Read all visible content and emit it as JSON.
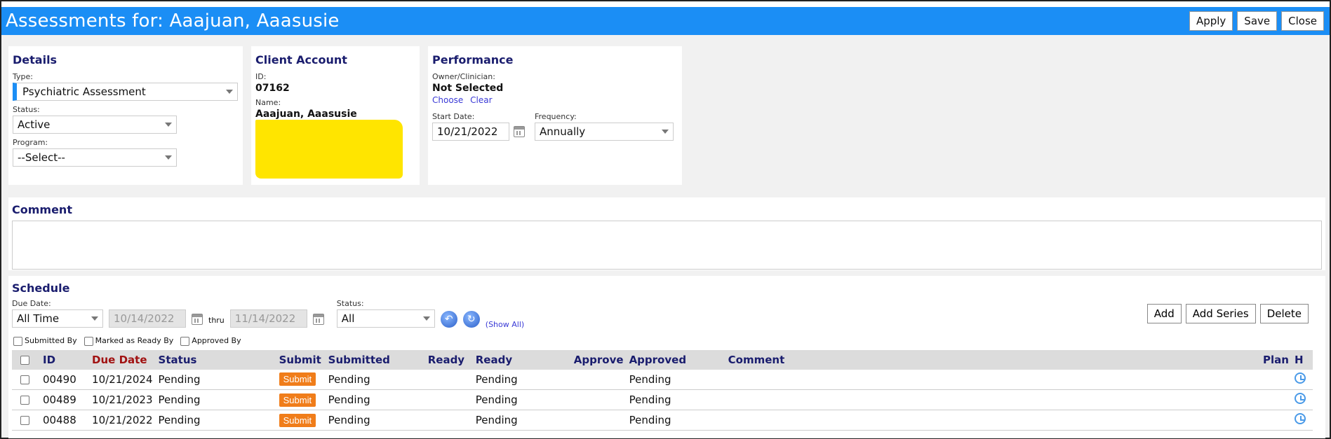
{
  "title": "Assessments for: Aaajuan, Aaasusie",
  "toolbar": {
    "apply": "Apply",
    "save": "Save",
    "close": "Close"
  },
  "details": {
    "heading": "Details",
    "type_label": "Type:",
    "type_value": "Psychiatric Assessment",
    "status_label": "Status:",
    "status_value": "Active",
    "program_label": "Program:",
    "program_value": "--Select--"
  },
  "client": {
    "heading": "Client Account",
    "id_label": "ID:",
    "id_value": "07162",
    "name_label": "Name:",
    "name_value": "Aaajuan, Aaasusie"
  },
  "performance": {
    "heading": "Performance",
    "owner_label": "Owner/Clinician:",
    "owner_value": "Not Selected",
    "choose": "Choose",
    "clear": "Clear",
    "start_label": "Start Date:",
    "start_value": "10/21/2022",
    "freq_label": "Frequency:",
    "freq_value": "Annually"
  },
  "comment": {
    "heading": "Comment",
    "value": ""
  },
  "schedule": {
    "heading": "Schedule",
    "due_label": "Due Date:",
    "due_value": "All Time",
    "from_date": "10/14/2022",
    "thru": "thru",
    "to_date": "11/14/2022",
    "status_label": "Status:",
    "status_value": "All",
    "show_all": "(Show All)",
    "add": "Add",
    "add_series": "Add Series",
    "delete": "Delete",
    "checks": [
      "Submitted By",
      "Marked as Ready By",
      "Approved By"
    ],
    "columns": [
      "ID",
      "Due Date",
      "Status",
      "Submit",
      "Submitted",
      "Ready",
      "Ready",
      "Approve",
      "Approved",
      "Comment",
      "Plan",
      "H"
    ],
    "submit_label": "Submit",
    "rows": [
      {
        "id": "00490",
        "due": "10/21/2024",
        "status": "Pending",
        "submitted": "Pending",
        "ready": "Pending",
        "approved": "Pending"
      },
      {
        "id": "00489",
        "due": "10/21/2023",
        "status": "Pending",
        "submitted": "Pending",
        "ready": "Pending",
        "approved": "Pending"
      },
      {
        "id": "00488",
        "due": "10/21/2022",
        "status": "Pending",
        "submitted": "Pending",
        "ready": "Pending",
        "approved": "Pending"
      }
    ]
  },
  "colors": {
    "titlebar": "#1b8ef5",
    "heading": "#1a1d6e",
    "submit": "#f07d1a",
    "redaction": "#ffe500"
  }
}
